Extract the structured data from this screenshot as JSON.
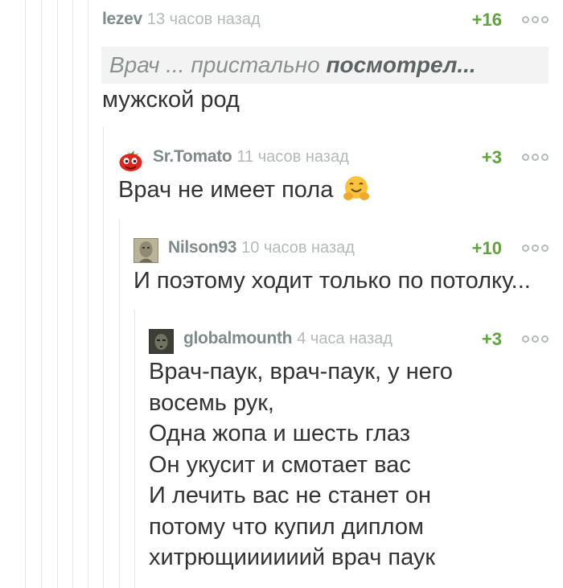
{
  "comments": [
    {
      "author": "lezev",
      "time": "13 часов назад",
      "rating": "+16",
      "quote_prefix": "Врач ... пристально ",
      "quote_bold": "посмотрел...",
      "text_lines": [
        "мужской род"
      ]
    },
    {
      "author": "Sr.Tomato",
      "time": "11 часов назад",
      "rating": "+3",
      "avatar": "tomato-avatar",
      "text_lines": [
        "Врач не имеет пола"
      ],
      "emoji": "🤗"
    },
    {
      "author": "Nilson93",
      "time": "10 часов назад",
      "rating": "+10",
      "avatar": "statue-avatar",
      "text_lines": [
        "И поэтому ходит только по потолку..."
      ]
    },
    {
      "author": "globalmounth",
      "time": "4 часа назад",
      "rating": "+3",
      "avatar": "dark-face-avatar",
      "text_lines": [
        "Врач-паук, врач-паук, у него",
        "восемь рук,",
        "Одна жопа и шесть глаз",
        "Он укусит и смотает вас",
        "И лечить вас не станет он",
        "потому что купил диплом",
        "хитрющиииииий врач паук"
      ]
    }
  ],
  "colors": {
    "rating": "#5ea33b",
    "author": "#7f8a8a",
    "time": "#b3b9b9",
    "text": "#333333",
    "thread_line": "#e6e6e6"
  }
}
